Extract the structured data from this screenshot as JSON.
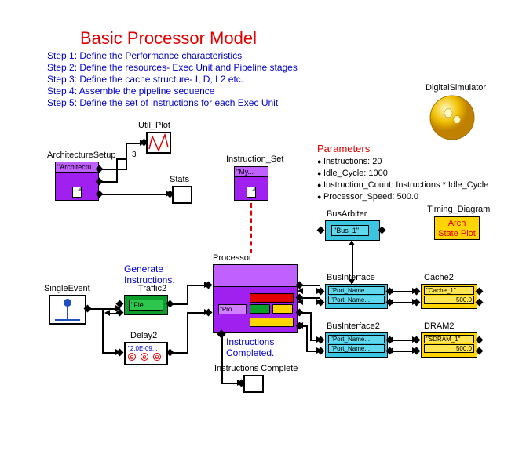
{
  "title": "Basic Processor Model",
  "steps": {
    "s1": "Step 1: Define the Performance characteristics",
    "s2": "Step 2: Define the resources- Exec Unit and Pipeline stages",
    "s3": "Step 3: Define the cache structure- I, D, L2 etc.",
    "s4": "Step 4: Assemble the pipeline sequence",
    "s5": "Step 5: Define the set of instructions for each Exec Unit"
  },
  "digital_simulator": "DigitalSimulator",
  "parameters_header": "Parameters",
  "parameters": {
    "p1": "Instructions: 20",
    "p2": "Idle_Cycle: 1000",
    "p3": "Instruction_Count: Instructions * Idle_Cycle",
    "p4": "Processor_Speed: 500.0"
  },
  "nodes": {
    "arch_setup": {
      "label": "ArchitectureSetup",
      "inner": "\"Architectu...",
      "port_count": "3"
    },
    "util_plot": {
      "label": "Util_Plot"
    },
    "stats": {
      "label": "Stats"
    },
    "instruction_set": {
      "label": "Instruction_Set",
      "inner": "\"My..."
    },
    "timing_diagram": {
      "label": "Timing_Diagram",
      "line1": "Arch",
      "line2": "State Plot"
    },
    "bus_arbiter": {
      "label": "BusArbiter",
      "inner": "\"Bus_1\""
    },
    "bus_interface": {
      "label": "BusInterface",
      "line1": "\"Port_Name...",
      "line2": "\"Port_Name..."
    },
    "bus_interface2": {
      "label": "BusInterface2",
      "line1": "\"Port_Name...",
      "line2": "\"Port_Name..."
    },
    "cache2": {
      "label": "Cache2",
      "line1": "\"Cache_1\"",
      "line2": "500.0"
    },
    "dram2": {
      "label": "DRAM2",
      "line1": "\"SDRAM_1\"",
      "line2": "500.0"
    },
    "single_event": {
      "label": "SingleEvent"
    },
    "generate": {
      "header": "Generate",
      "header2": "Instructions.",
      "traffic_label": "Traffic2",
      "traffic_inner": "\"Fie..."
    },
    "delay2": {
      "label": "Delay2",
      "inner": "\"2.0E-09...",
      "e": "e"
    },
    "processor": {
      "label": "Processor",
      "inner": "\"Pro..."
    },
    "instr_completed": {
      "header1": "Instructions",
      "header2": "Completed.",
      "label": "Instructions Complete"
    }
  }
}
